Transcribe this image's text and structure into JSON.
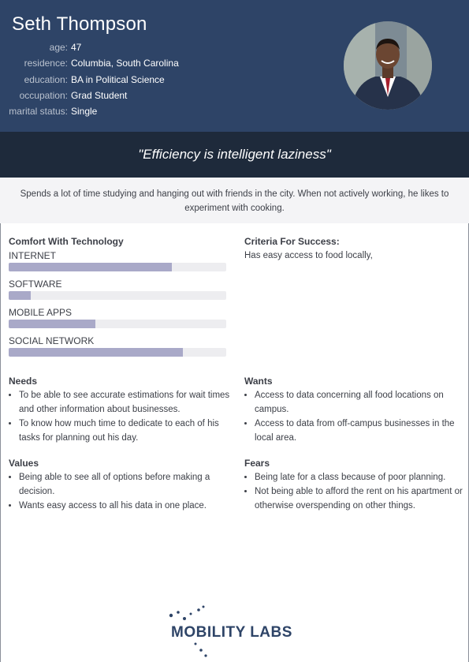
{
  "persona": {
    "name": "Seth Thompson",
    "facts": [
      {
        "label": "age:",
        "value": "47"
      },
      {
        "label": "residence:",
        "value": "Columbia, South Carolina"
      },
      {
        "label": "education:",
        "value": "BA in Political Science"
      },
      {
        "label": "occupation:",
        "value": "Grad Student"
      },
      {
        "label": "marital status:",
        "value": "Single"
      }
    ],
    "photo_icon": "person-portrait-icon"
  },
  "quote": "\"Efficiency is intelligent laziness\"",
  "bio": "Spends a lot of time studying and hanging out with friends in the city. When not actively working, he likes to experiment with cooking.",
  "comfort": {
    "title": "Comfort With Technology",
    "bars": [
      {
        "label": "INTERNET",
        "level": 0.75
      },
      {
        "label": "SOFTWARE",
        "level": 0.1
      },
      {
        "label": "MOBILE APPS",
        "level": 0.4
      },
      {
        "label": "SOCIAL NETWORK",
        "level": 0.8
      }
    ],
    "bar_color": "#a9a9c8",
    "track_color": "#ededf0"
  },
  "criteria": {
    "title": "Criteria For Success:",
    "text": "Has easy access to food locally,"
  },
  "needs": {
    "title": "Needs",
    "items": [
      "To be able to see accurate estimations for wait times and other information about businesses.",
      "To know how much time to dedicate to each of his tasks for planning out his day."
    ]
  },
  "wants": {
    "title": "Wants",
    "items": [
      "Access to data concerning all food locations on campus.",
      "Access to data from off-campus businesses in the local area."
    ]
  },
  "values": {
    "title": "Values",
    "items": [
      "Being able to see all of options before making a decision.",
      "Wants easy access to all his data in one place."
    ]
  },
  "fears": {
    "title": "Fears",
    "items": [
      "Being late for a class because of poor planning.",
      "Not being able to afford the rent on his apartment or otherwise overspending on other things."
    ]
  },
  "logo": {
    "text": "MOBILITY LABS",
    "icon": "dot-orbit-logo-icon"
  },
  "colors": {
    "header": "#2e4467",
    "quote_bar": "#1e2a3b",
    "bio_bar": "#f4f4f6"
  }
}
